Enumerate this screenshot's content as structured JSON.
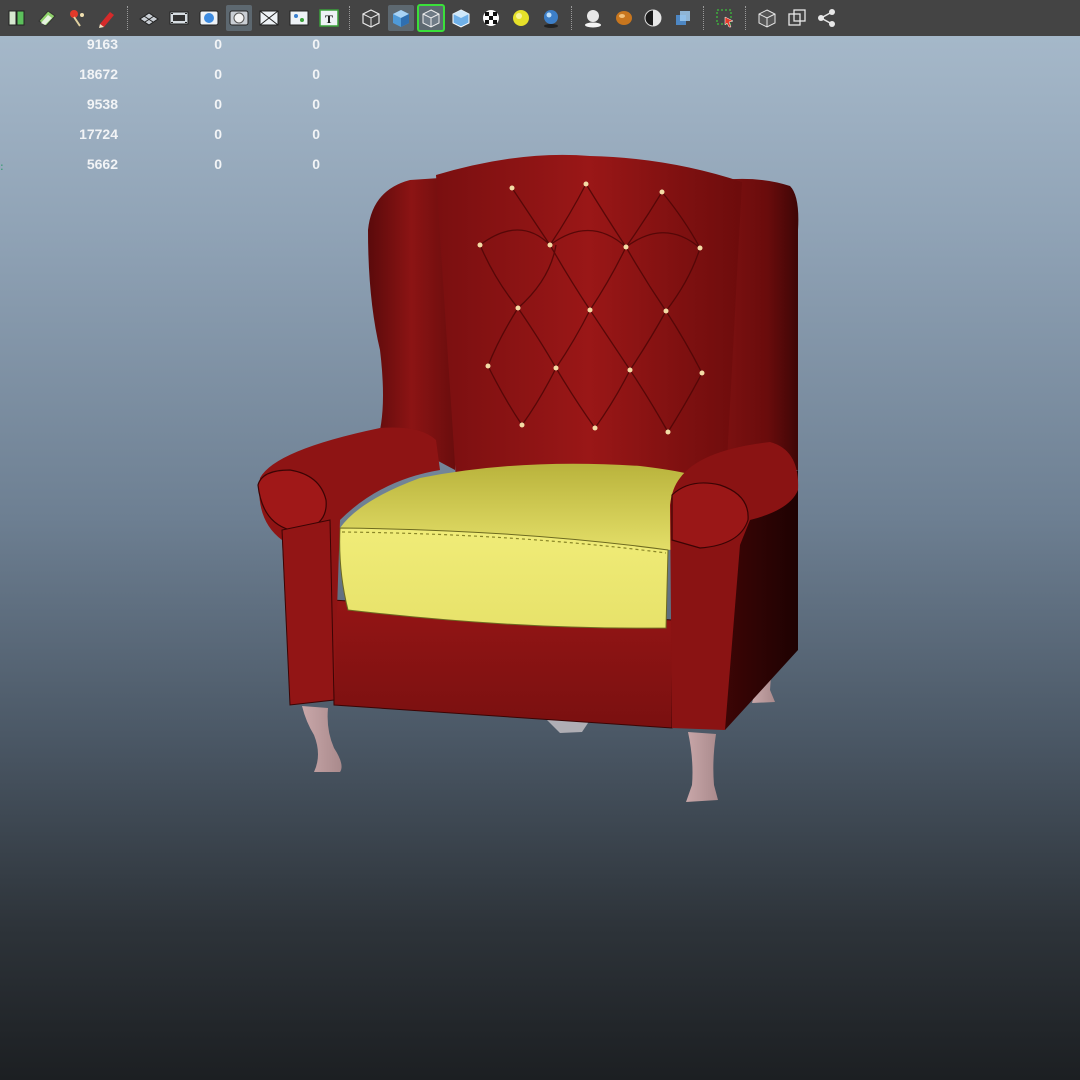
{
  "toolbar": {
    "icons": [
      "camera-attributes-icon",
      "bookmark-icon",
      "image-plane-icon",
      "grease-pencil-icon",
      "grid-icon",
      "film-gate-icon",
      "resolution-gate-icon",
      "gate-mask-icon",
      "field-chart-icon",
      "safe-action-icon",
      "safe-title-icon",
      "wireframe-icon",
      "smooth-shade-icon",
      "wireframe-on-shaded-icon",
      "default-material-icon",
      "textured-icon",
      "use-all-lights-icon",
      "shadows-icon",
      "screen-space-ao-icon",
      "motion-blur-icon",
      "anti-aliasing-icon",
      "depth-of-field-icon",
      "isolate-select-icon",
      "xray-icon",
      "xray-joints-icon",
      "xray-active-components-icon"
    ],
    "active": [
      "smooth-shade-icon",
      "wireframe-on-shaded-icon",
      "default-material-icon"
    ]
  },
  "hud": {
    "rows": [
      {
        "a": "9163",
        "b": "0",
        "c": "0"
      },
      {
        "a": "18672",
        "b": "0",
        "c": "0"
      },
      {
        "a": "9538",
        "b": "0",
        "c": "0"
      },
      {
        "a": "17724",
        "b": "0",
        "c": "0"
      },
      {
        "a": "5662",
        "b": "0",
        "c": "0"
      }
    ],
    "marker": ":"
  },
  "viewport": {
    "background_top": "#a9bccd",
    "background_bottom": "#1c1f22",
    "model_colors": {
      "upholstery": "#8a1212",
      "cushion": "#e9e66a",
      "legs": "#c7a3a6",
      "buttons": "#f3dca6"
    }
  }
}
